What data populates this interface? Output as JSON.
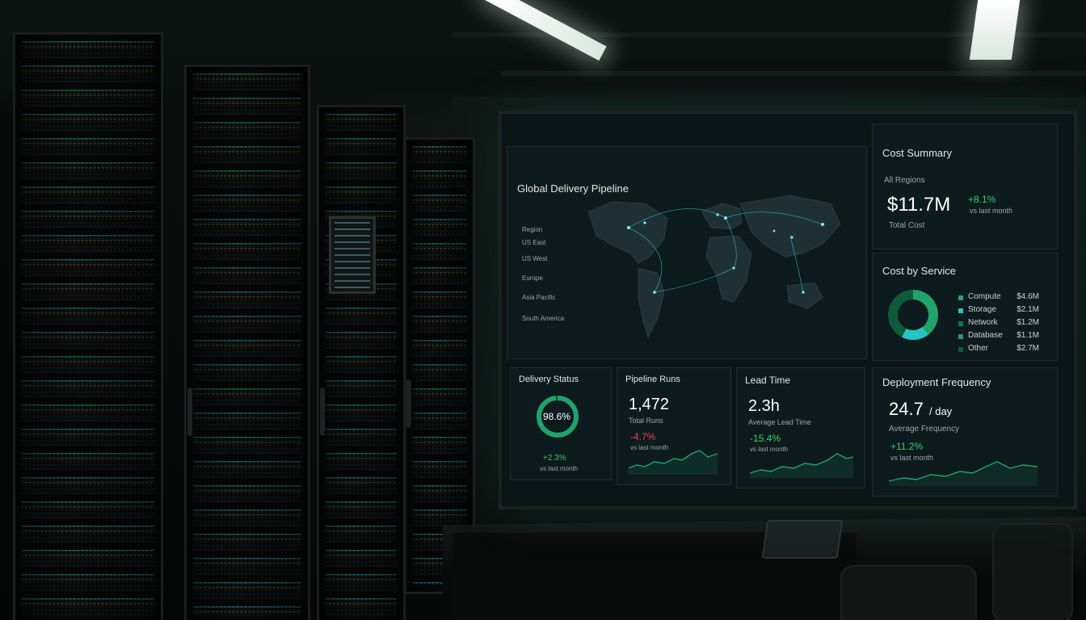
{
  "map_panel": {
    "title": "Global Delivery Pipeline",
    "regions": [
      "Region",
      "US East",
      "US West",
      "Europe",
      "Asia Pacific",
      "South America"
    ]
  },
  "cost_summary": {
    "title": "Cost Summary",
    "scope": "All Regions",
    "value": "$11.7M",
    "value_label": "Total Cost",
    "change": "+8.1%",
    "change_label": "vs last month"
  },
  "cost_by_service": {
    "title": "Cost by Service",
    "items": [
      {
        "name": "Compute",
        "value": "$4.6M"
      },
      {
        "name": "Storage",
        "value": "$2.1M"
      },
      {
        "name": "Network",
        "value": "$1.2M"
      },
      {
        "name": "Database",
        "value": "$1.1M"
      },
      {
        "name": "Other",
        "value": "$2.7M"
      }
    ]
  },
  "delivery_status": {
    "title": "Delivery Status",
    "value": "98.6%",
    "change": "+2.3%",
    "change_label": "vs last month"
  },
  "pipeline_runs": {
    "title": "Pipeline Runs",
    "value": "1,472",
    "value_label": "Total Runs",
    "change": "-4.7%",
    "change_label": "vs last month"
  },
  "lead_time": {
    "title": "Lead Time",
    "value": "2.3h",
    "value_label": "Average Lead Time",
    "change": "-15.4%",
    "change_label": "vs last month"
  },
  "deployment_frequency": {
    "title": "Deployment Frequency",
    "value": "24.7",
    "unit": "/ day",
    "value_label": "Average Frequency",
    "change": "+11.2%",
    "change_label": "vs last month"
  },
  "colors": {
    "positive": "#34d06b",
    "negative": "#e24848",
    "accent": "#1fa36a",
    "map_glow": "#27c4c4"
  }
}
